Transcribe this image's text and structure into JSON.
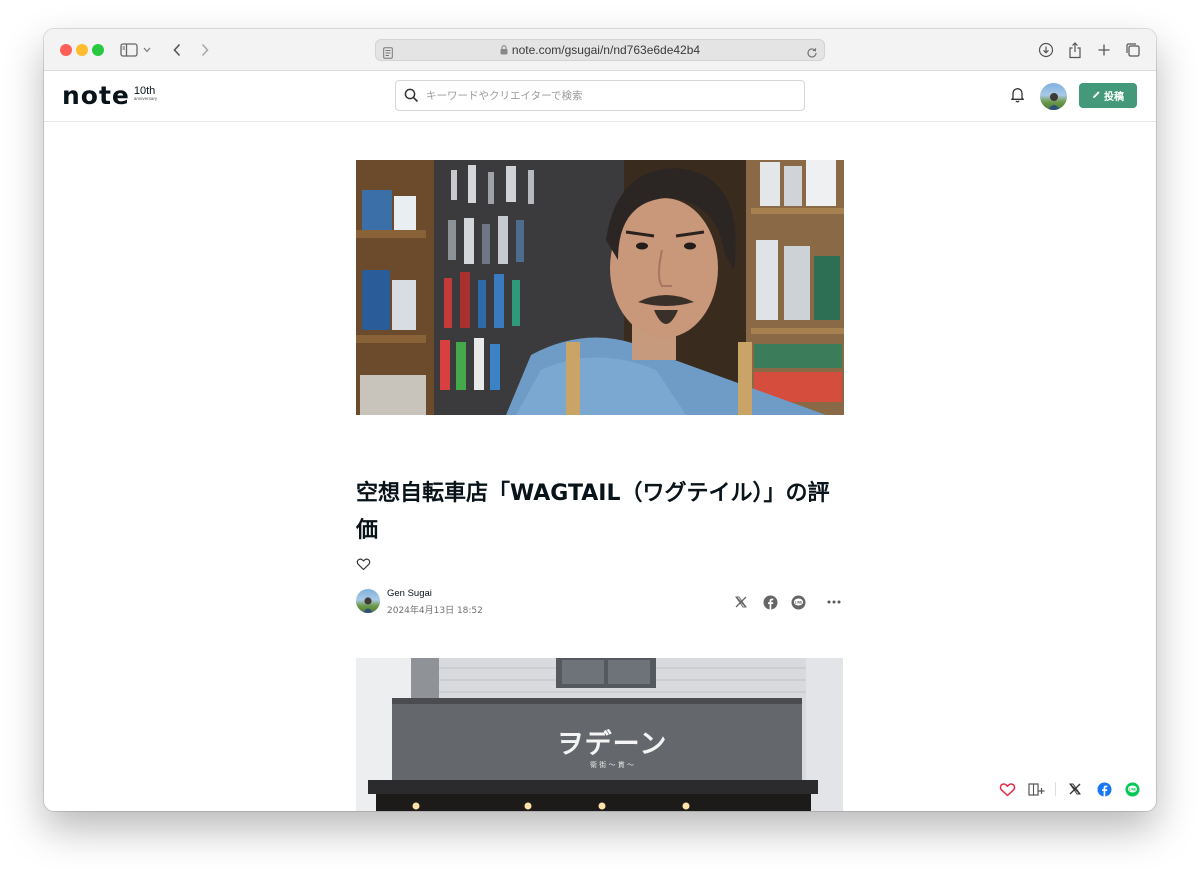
{
  "browser": {
    "url": "note.com/gsugai/n/nd763e6de42b4"
  },
  "header": {
    "logo_text": "note",
    "logo_badge": "10th",
    "logo_badge_sub": "anniversary",
    "search_placeholder": "キーワードやクリエイターで検索",
    "post_button_label": "投稿"
  },
  "article": {
    "title": "空想自転車店「WAGTAIL（ワグテイル）」の評価",
    "author": "Gen Sugai",
    "date": "2024年4月13日 18:52",
    "second_image_sign": "ヲデーン",
    "second_image_sign_sub": "衛 街 ～ 貫 ～"
  },
  "colors": {
    "accent": "#43997a",
    "like_red": "#e02b48",
    "facebook": "#1877f2",
    "line": "#06c755"
  }
}
